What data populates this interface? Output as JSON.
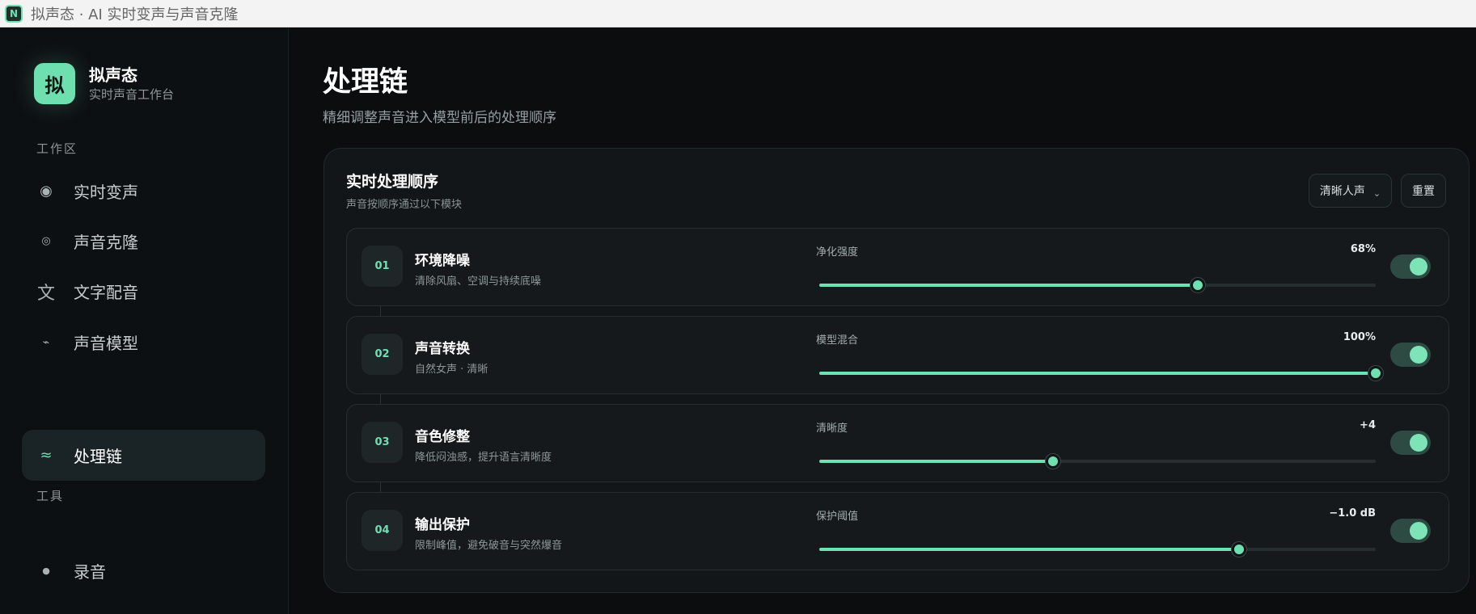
{
  "window": {
    "title": "拟声态 · AI 实时变声与声音克隆",
    "app_icon_glyph": "N"
  },
  "brand": {
    "logo_glyph": "拟",
    "name": "拟声态",
    "subtitle": "实时声音工作台"
  },
  "sidebar": {
    "section_workspace": "工作区",
    "section_tools": "工具",
    "items": [
      {
        "label": "实时变声",
        "icon": "radio-button-icon",
        "glyph": "◉",
        "active": false
      },
      {
        "label": "声音克隆",
        "icon": "target-icon",
        "glyph": "◎",
        "active": false
      },
      {
        "label": "文字配音",
        "icon": "text-icon",
        "glyph": "文",
        "active": false
      },
      {
        "label": "声音模型",
        "icon": "waveform-icon",
        "glyph": "⌁",
        "active": false
      },
      {
        "label": "处理链",
        "icon": "wave-chain-icon",
        "glyph": "≈",
        "active": true
      },
      {
        "label": "录音",
        "icon": "record-dot-icon",
        "glyph": "●",
        "active": false
      }
    ]
  },
  "page": {
    "title": "处理链",
    "subtitle": "精细调整声音进入模型前后的处理顺序"
  },
  "card": {
    "title": "实时处理顺序",
    "subtitle": "声音按顺序通过以下模块",
    "preset_label": "清晰人声",
    "preset_chevron": "⌄",
    "reset_label": "重置"
  },
  "modules": [
    {
      "num": "01",
      "name": "环境降噪",
      "desc": "清除风扇、空调与持续底噪",
      "param_label": "净化强度",
      "param_value": "68%",
      "level": 0.68,
      "enabled": true
    },
    {
      "num": "02",
      "name": "声音转换",
      "desc": "自然女声 · 清晰",
      "param_label": "模型混合",
      "param_value": "100%",
      "level": 1.0,
      "enabled": true
    },
    {
      "num": "03",
      "name": "音色修整",
      "desc": "降低闷浊感，提升语言清晰度",
      "param_label": "清晰度",
      "param_value": "+4",
      "level": 0.42,
      "enabled": true
    },
    {
      "num": "04",
      "name": "输出保护",
      "desc": "限制峰值，避免破音与突然爆音",
      "param_label": "保护阈值",
      "param_value": "−1.0 dB",
      "level": 0.755,
      "enabled": true
    }
  ],
  "colors": {
    "accent": "#6fe0b2",
    "background": "#0b0d0f",
    "card": "#121618"
  }
}
